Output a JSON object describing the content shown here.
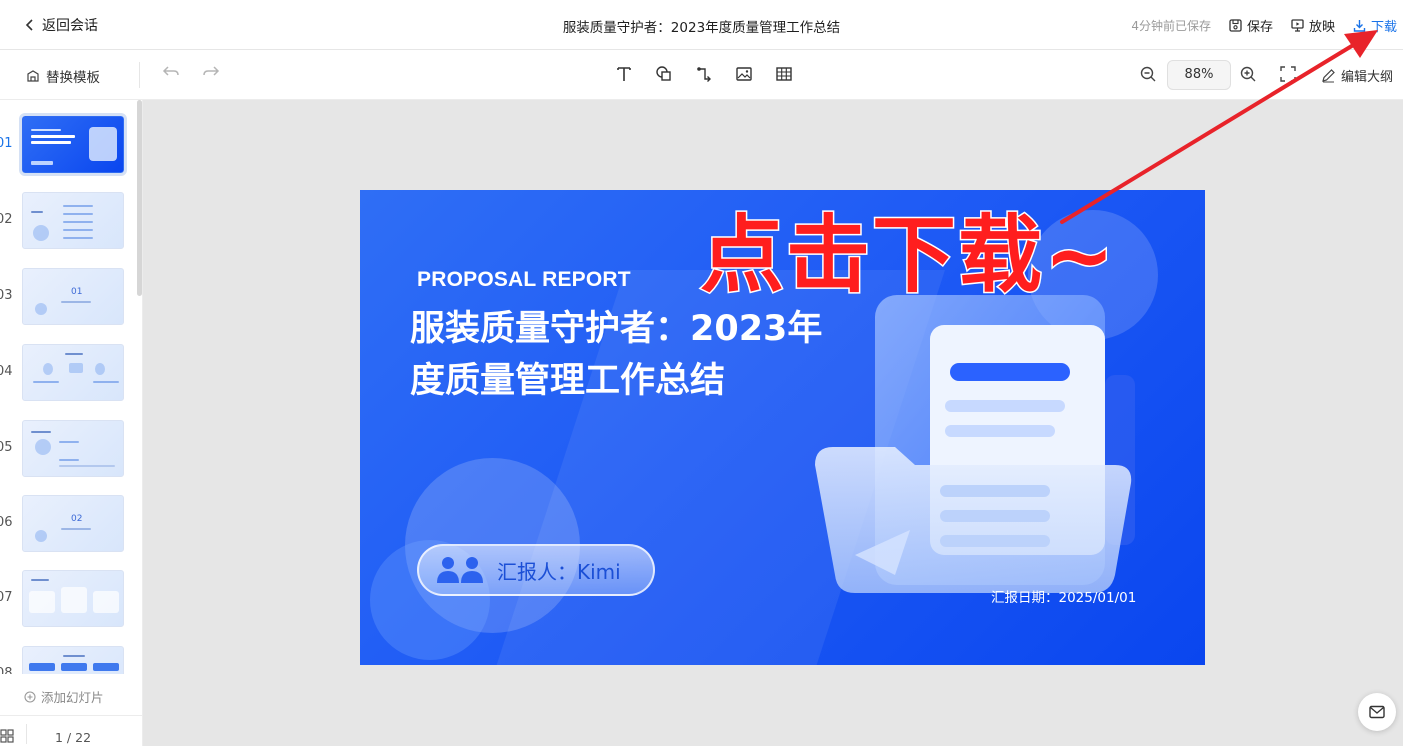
{
  "header": {
    "back_label": "返回会话",
    "doc_title": "服装质量守护者：2023年度质量管理工作总结",
    "saved_status": "4分钟前已保存",
    "save_label": "保存",
    "present_label": "放映",
    "download_label": "下载"
  },
  "toolbar": {
    "template_label": "替换模板",
    "zoom_value": "88%",
    "edit_outline_label": "编辑大纲",
    "tools": [
      "text-icon",
      "shape-icon",
      "connector-icon",
      "image-icon",
      "table-icon"
    ]
  },
  "sidebar": {
    "thumbnails": [
      {
        "num": "01"
      },
      {
        "num": "02"
      },
      {
        "num": "03",
        "big": "01"
      },
      {
        "num": "04"
      },
      {
        "num": "05"
      },
      {
        "num": "06",
        "big": "02"
      },
      {
        "num": "07"
      },
      {
        "num": "08"
      }
    ],
    "add_slide_label": "添加幻灯片",
    "page_indicator": "1 / 22"
  },
  "slide": {
    "kicker": "PROPOSAL REPORT",
    "title": "服装质量守护者：2023年度质量管理工作总结",
    "reporter": "汇报人：Kimi",
    "date": "汇报日期：2025/01/01"
  },
  "annotation": {
    "callout_text": "点击下载~",
    "color": "#ff1e1e"
  },
  "colors": {
    "accent": "#1a73e8",
    "slide_blue": "#1f5bf5"
  }
}
